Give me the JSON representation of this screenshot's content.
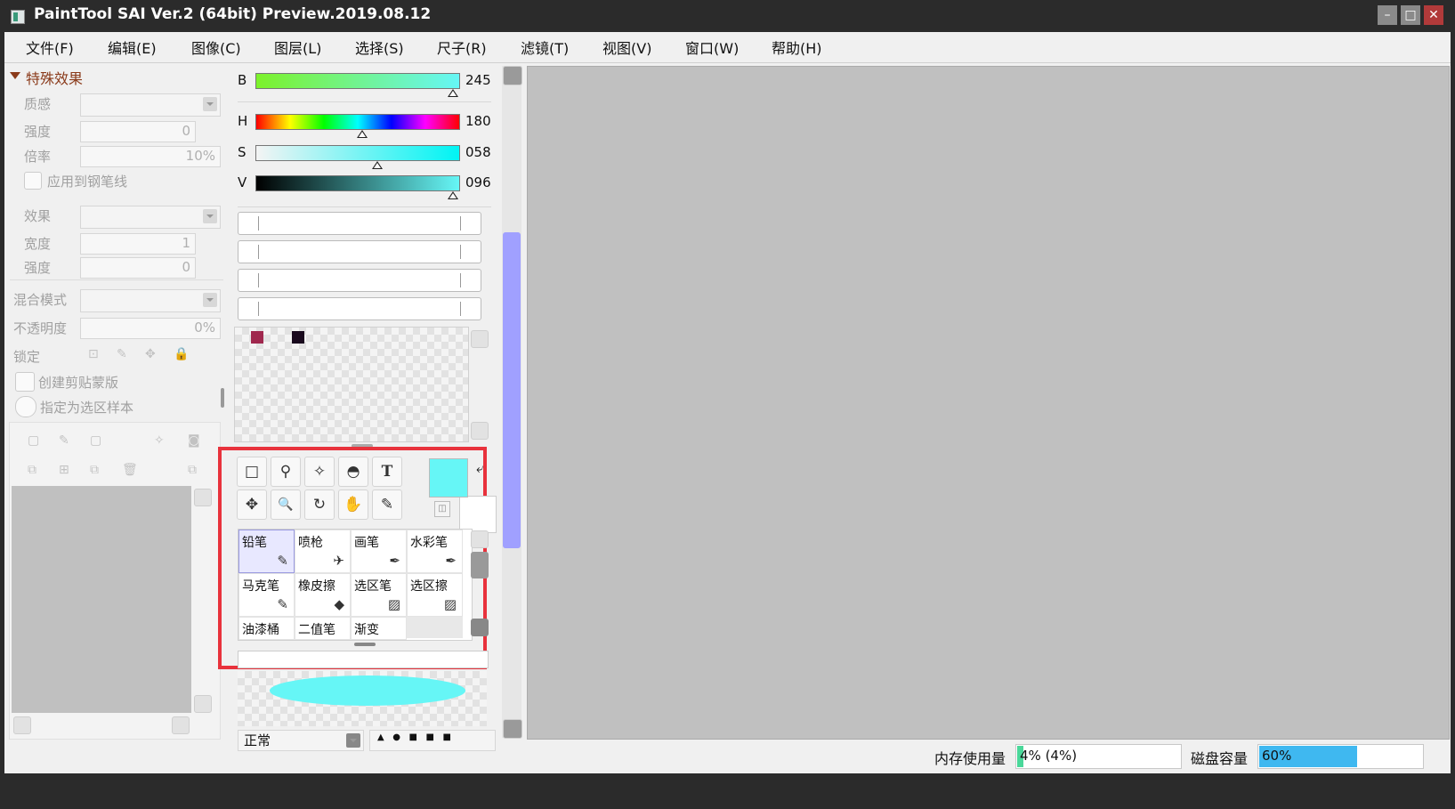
{
  "window": {
    "title": "PaintTool SAI Ver.2 (64bit) Preview.2019.08.12",
    "minimize": "–",
    "maximize": "□",
    "close": "✕"
  },
  "menu": [
    "文件(F)",
    "编辑(E)",
    "图像(C)",
    "图层(L)",
    "选择(S)",
    "尺子(R)",
    "滤镜(T)",
    "视图(V)",
    "窗口(W)",
    "帮助(H)"
  ],
  "left_panel": {
    "section_title": "特殊效果",
    "texture_label": "质感",
    "strength1_label": "强度",
    "strength1_value": "0",
    "rate_label": "倍率",
    "rate_value": "10%",
    "apply_pen_label": "应用到钢笔线",
    "effect_label": "效果",
    "width_label": "宽度",
    "width_value": "1",
    "strength2_label": "强度",
    "strength2_value": "0",
    "blend_label": "混合模式",
    "opacity_label": "不透明度",
    "opacity_value": "0%",
    "lock_label": "锁定",
    "clip_label": "创建剪贴蒙版",
    "select_sample_label": "指定为选区样本"
  },
  "color_sliders": [
    {
      "label": "B",
      "value": "245"
    },
    {
      "label": "H",
      "value": "180"
    },
    {
      "label": "S",
      "value": "058"
    },
    {
      "label": "V",
      "value": "096"
    }
  ],
  "colors": {
    "foreground": "#66f6f6",
    "swatch1": "#a0284e",
    "swatch2": "#1a0a1e",
    "highlight_box": "#e8323c",
    "scrollbar_thumb": "#a0a0ff"
  },
  "tools": [
    "□",
    "⚲",
    "✧",
    "◓",
    "T",
    "✥",
    "🔍",
    "↻",
    "✋",
    "✎"
  ],
  "brushes": [
    {
      "label": "铅笔",
      "icon": "✎"
    },
    {
      "label": "喷枪",
      "icon": "✈"
    },
    {
      "label": "画笔",
      "icon": "✒"
    },
    {
      "label": "水彩笔",
      "icon": "✒"
    },
    {
      "label": "马克笔",
      "icon": "✎"
    },
    {
      "label": "橡皮擦",
      "icon": "◆"
    },
    {
      "label": "选区笔",
      "icon": "▨"
    },
    {
      "label": "选区擦",
      "icon": "▨"
    },
    {
      "label": "油漆桶",
      "icon": ""
    },
    {
      "label": "二值笔",
      "icon": ""
    },
    {
      "label": "渐变",
      "icon": ""
    }
  ],
  "brush_mode": "正常",
  "status": {
    "memory_label": "内存使用量",
    "memory_value": "4% (4%)",
    "memory_fraction": 0.04,
    "disk_label": "磁盘容量",
    "disk_value": "60%",
    "disk_fraction": 0.6
  }
}
